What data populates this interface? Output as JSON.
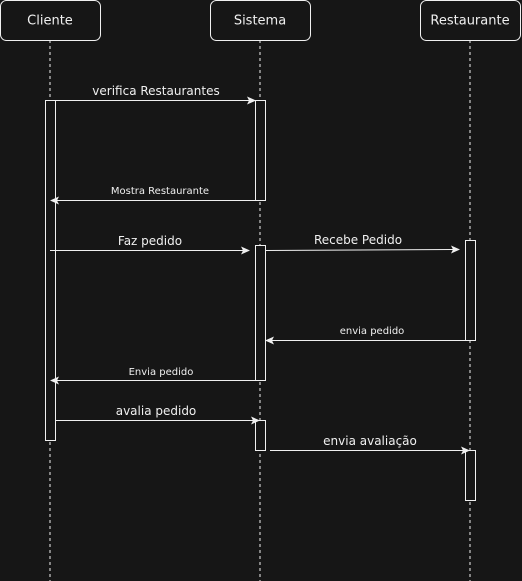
{
  "actors": [
    {
      "id": "cliente",
      "label": "Cliente"
    },
    {
      "id": "sistema",
      "label": "Sistema"
    },
    {
      "id": "restaurante",
      "label": "Restaurante"
    }
  ],
  "messages": [
    {
      "from": "cliente",
      "to": "sistema",
      "label": "verifica Restaurantes"
    },
    {
      "from": "sistema",
      "to": "cliente",
      "label": "Mostra Restaurante"
    },
    {
      "from": "cliente",
      "to": "sistema",
      "label": "Faz pedido"
    },
    {
      "from": "sistema",
      "to": "restaurante",
      "label": "Recebe Pedido"
    },
    {
      "from": "restaurante",
      "to": "sistema",
      "label": "envia pedido"
    },
    {
      "from": "sistema",
      "to": "cliente",
      "label": "Envia pedido"
    },
    {
      "from": "cliente",
      "to": "sistema",
      "label": "avalia pedido"
    },
    {
      "from": "sistema",
      "to": "restaurante",
      "label": "envia avaliação"
    }
  ]
}
